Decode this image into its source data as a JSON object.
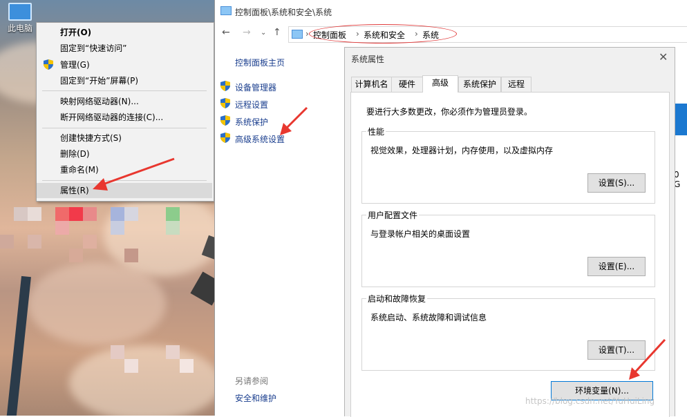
{
  "desktop": {
    "icon_label": "此电脑"
  },
  "context_menu": {
    "items": [
      {
        "label": "打开(O)"
      },
      {
        "label": "固定到“快速访问”"
      },
      {
        "label": "管理(G)"
      },
      {
        "label": "固定到“开始”屏幕(P)"
      },
      {
        "label": "映射网络驱动器(N)..."
      },
      {
        "label": "断开网络驱动器的连接(C)..."
      },
      {
        "label": "创建快捷方式(S)"
      },
      {
        "label": "删除(D)"
      },
      {
        "label": "重命名(M)"
      },
      {
        "label": "属性(R)"
      }
    ]
  },
  "window": {
    "title": "控制面板\\系统和安全\\系统",
    "breadcrumb": [
      "控制面板",
      "系统和安全",
      "系统"
    ],
    "left_pane": {
      "home": "控制面板主页",
      "links": [
        "设备管理器",
        "远程设置",
        "系统保护",
        "高级系统设置"
      ],
      "see_also": "另请参阅",
      "security": "安全和维护"
    },
    "partial_text": "0 G"
  },
  "dialog": {
    "title": "系统属性",
    "tabs": [
      "计算机名",
      "硬件",
      "高级",
      "系统保护",
      "远程"
    ],
    "active_tab": "高级",
    "admin_note": "要进行大多数更改，你必须作为管理员登录。",
    "performance": {
      "title": "性能",
      "desc": "视觉效果，处理器计划，内存使用，以及虚拟内存",
      "button": "设置(S)..."
    },
    "user_profiles": {
      "title": "用户配置文件",
      "desc": "与登录帐户相关的桌面设置",
      "button": "设置(E)..."
    },
    "startup": {
      "title": "启动和故障恢复",
      "desc": "系统启动、系统故障和调试信息",
      "button": "设置(T)..."
    },
    "env_button": "环境变量(N)..."
  },
  "watermark": "https://blog.csdn.net/YuHuiLing",
  "colors": {
    "arrow": "#e8372f",
    "link": "#1a3e8e",
    "accent": "#0078d7"
  }
}
